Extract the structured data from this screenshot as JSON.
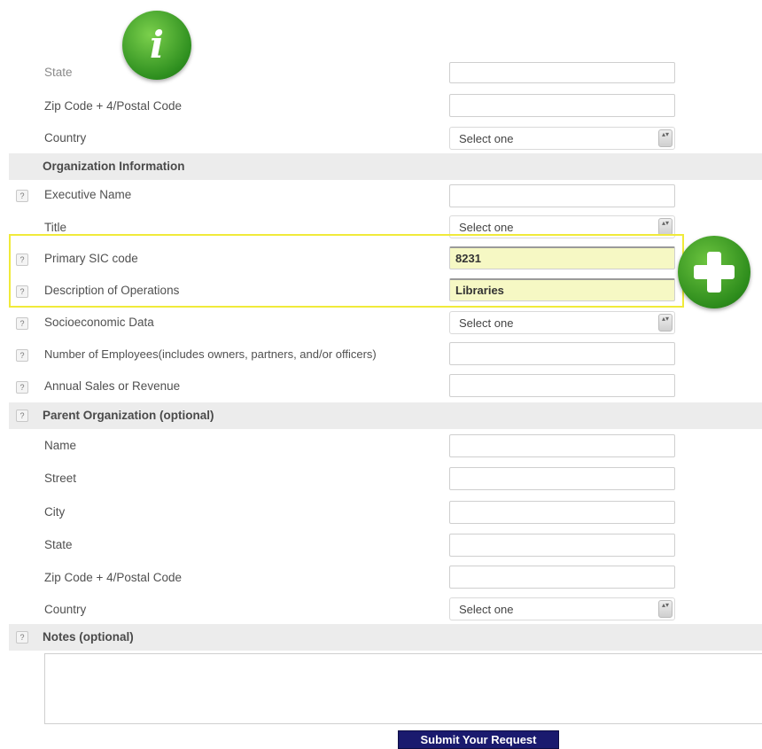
{
  "address": {
    "state_label": "State",
    "zip_label": "Zip Code + 4/Postal Code",
    "country_label": "Country",
    "country_value": "Select one"
  },
  "organization": {
    "section_title": "Organization Information",
    "executive_name_label": "Executive Name",
    "title_label": "Title",
    "title_value": "Select one",
    "sic_label": "Primary SIC code",
    "sic_value": "8231",
    "operations_label": "Description of Operations",
    "operations_value": "Libraries",
    "socioeconomic_label": "Socioeconomic Data",
    "socioeconomic_value": "Select one",
    "employees_label": "Number of Employees(includes owners, partners, and/or officers)",
    "revenue_label": "Annual Sales or Revenue"
  },
  "parent": {
    "section_title": "Parent Organization (optional)",
    "name_label": "Name",
    "street_label": "Street",
    "city_label": "City",
    "state_label": "State",
    "zip_label": "Zip Code + 4/Postal Code",
    "country_label": "Country",
    "country_value": "Select one"
  },
  "notes": {
    "section_title": "Notes (optional)"
  },
  "help_glyph": "?",
  "select_arrow_glyph": "▴▾",
  "submit_label": "Submit Your Request",
  "icons": {
    "info": "i",
    "info_name": "info-icon",
    "plus_name": "plus-icon",
    "help_name": "help-icon"
  },
  "colors": {
    "highlight_border": "#f0ea3a",
    "highlight_fill": "#f6f8c4",
    "icon_green": "#2e8f1f",
    "submit_bg": "#1a1a6e",
    "section_bg": "#ececec"
  }
}
